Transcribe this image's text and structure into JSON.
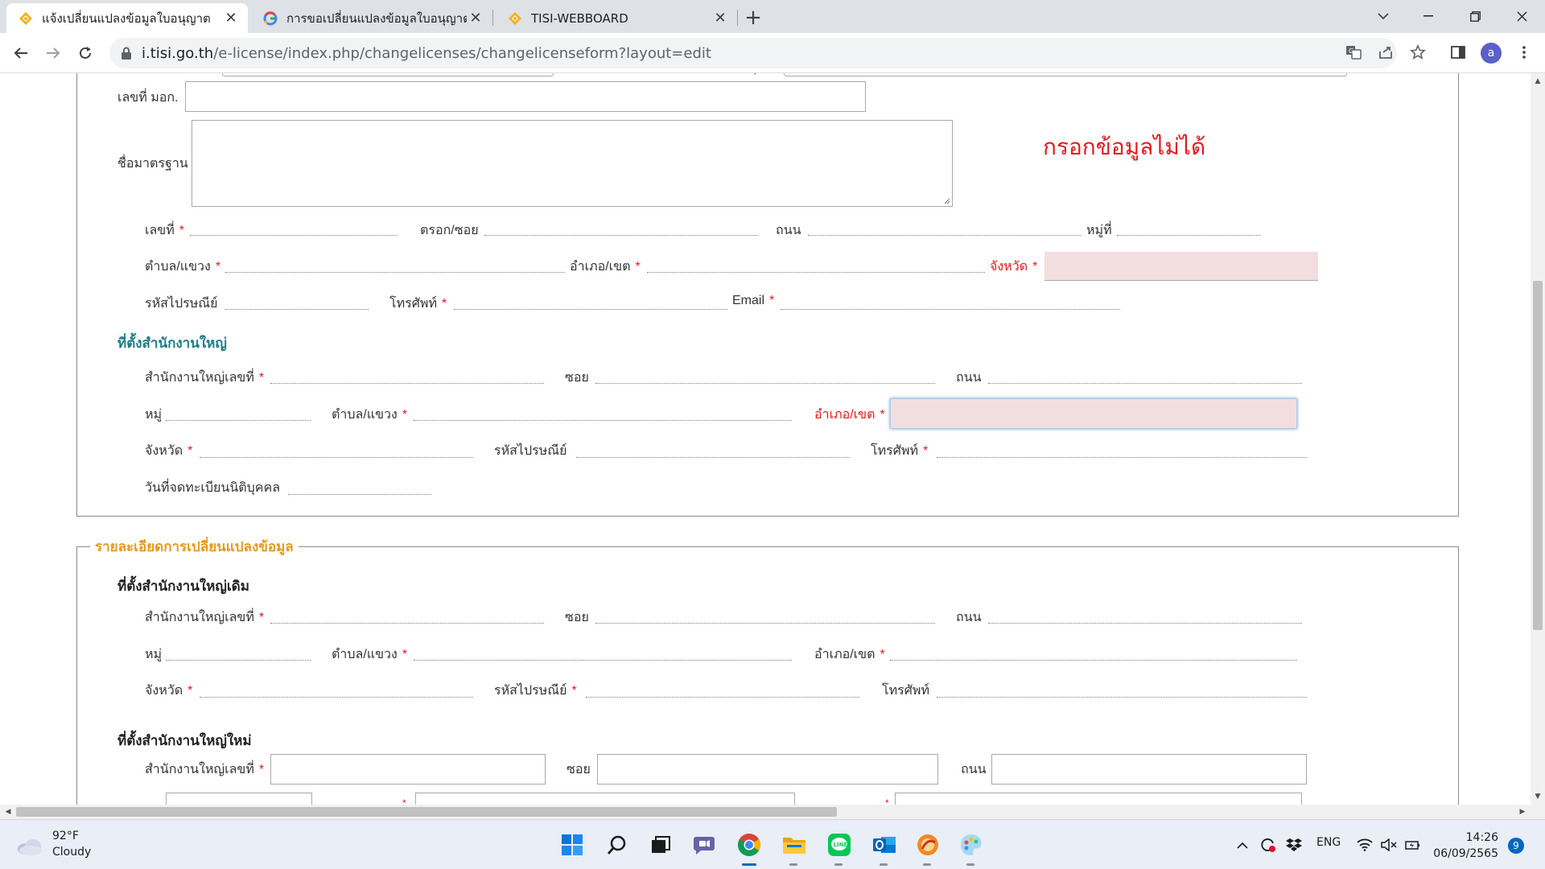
{
  "browser": {
    "tabs": [
      {
        "title": "แจ้งเปลี่ยนแปลงข้อมูลใบอนุญาต",
        "active": true
      },
      {
        "title": "การขอเปลี่ยนแปลงข้อมูลใบอนุญาต สมอ",
        "active": false
      },
      {
        "title": "TISI-WEBBOARD",
        "active": false
      }
    ],
    "close_glyph": "✕",
    "new_tab_glyph": "+",
    "url_host": "i.tisi.go.th",
    "url_path": "/e-license/index.php/changelicenses/changelicenseform?layout=edit",
    "profile_initial": "a"
  },
  "form": {
    "top": {
      "mok_number_label": "เลขที่ มอก.",
      "standard_name_label": "ชื่อมาตรฐาน",
      "annotation": "กรอกข้อมูลไม่ได้",
      "number_label": "เลขที่",
      "alley_label": "ตรอก/ซอย",
      "road_label": "ถนน",
      "moo_label": "หมู่ที่",
      "subdistrict_label": "ตำบล/แขวง",
      "district_label": "อำเภอ/เขต",
      "province_label": "จังหวัด",
      "postcode_label": "รหัสไปรษณีย์",
      "phone_label": "โทรศัพท์",
      "email_label": "Email",
      "required_mark": "*"
    },
    "head_office": {
      "title": "ที่ตั้งสำนักงานใหญ่",
      "number_label": "สำนักงานใหญ่เลขที่",
      "soi_label": "ซอย",
      "road_label": "ถนน",
      "moo_label": "หมู่",
      "subdistrict_label": "ตำบล/แขวง",
      "district_label": "อำเภอ/เขต",
      "province_label": "จังหวัด",
      "postcode_label": "รหัสไปรษณีย์",
      "phone_label": "โทรศัพท์",
      "registration_date_label": "วันที่จดทะเบียนนิติบุคคล"
    },
    "change_details": {
      "legend": "รายละเอียดการเปลี่ยนแปลงข้อมูล",
      "old_title": "ที่ตั้งสำนักงานใหญ่เดิม",
      "new_title": "ที่ตั้งสำนักงานใหญ่ใหม่",
      "number_label": "สำนักงานใหญ่เลขที่",
      "soi_label": "ซอย",
      "road_label": "ถนน",
      "moo_label": "หมู่",
      "subdistrict_label": "ตำบล/แขวง",
      "district_label": "อำเภอ/เขต",
      "province_label": "จังหวัด",
      "postcode_label": "รหัสไปรษณีย์",
      "phone_label": "โทรศัพท์"
    }
  },
  "taskbar": {
    "weather_temp": "92°F",
    "weather_desc": "Cloudy",
    "language": "ENG",
    "time": "14:26",
    "date": "06/09/2565",
    "notification_count": "9"
  },
  "colors": {
    "accent_teal": "#1b7f86",
    "legend_orange": "#e59a1c",
    "required_red": "#e0191f",
    "error_field_pink": "#f2dede"
  }
}
